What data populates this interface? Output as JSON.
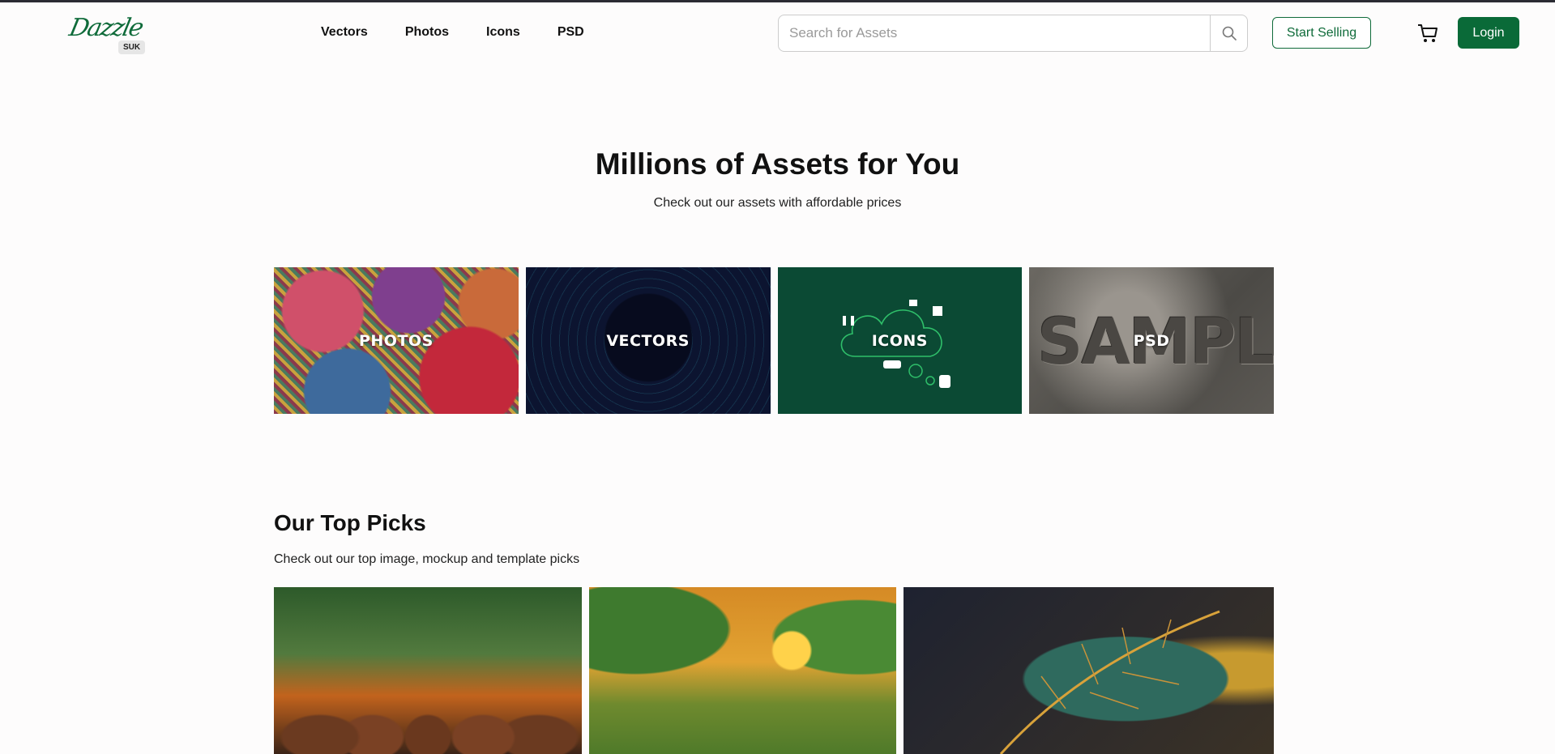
{
  "header": {
    "logo_text": "Dazzle",
    "logo_badge": "SUK",
    "nav": [
      "Vectors",
      "Photos",
      "Icons",
      "PSD"
    ],
    "search_placeholder": "Search for Assets",
    "start_selling": "Start Selling",
    "login": "Login",
    "accent": "#0a6a38"
  },
  "hero": {
    "title": "Millions of Assets for You",
    "subtitle": "Check out our assets with affordable prices"
  },
  "categories": [
    {
      "label": "PHOTOS"
    },
    {
      "label": "VECTORS"
    },
    {
      "label": "ICONS"
    },
    {
      "label": "PSD",
      "background_text": "SAMPLE"
    }
  ],
  "top_picks": {
    "title": "Our Top Picks",
    "subtitle": "Check out our top image, mockup and template picks"
  }
}
